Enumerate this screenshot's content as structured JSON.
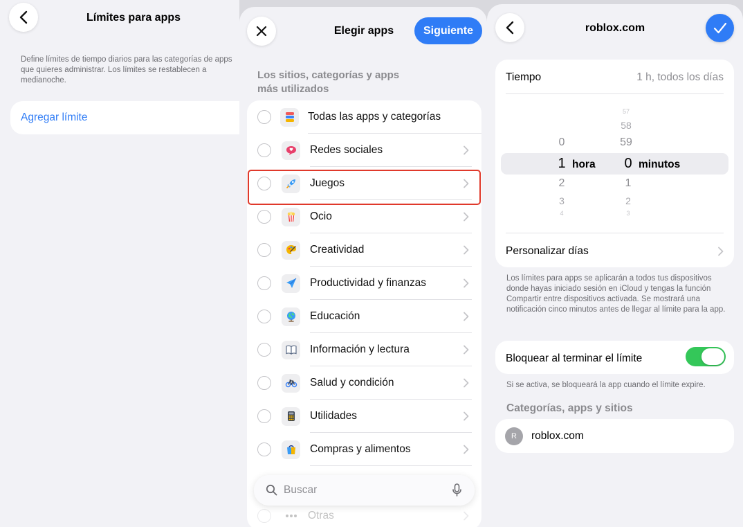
{
  "panel1": {
    "title": "Límites para apps",
    "description": "Define límites de tiempo diarios para las categorías de apps que quieres administrar. Los límites se restablecen a medianoche.",
    "add_limit": "Agregar límite"
  },
  "panel2": {
    "title": "Elegir apps",
    "next_label": "Siguiente",
    "section_header": "Los sitios, categorías y apps más utilizados",
    "items": [
      {
        "label": "Todas las apps y categorías",
        "icon": "stack-icon"
      },
      {
        "label": "Redes sociales",
        "icon": "chat-bubble-icon"
      },
      {
        "label": "Juegos",
        "icon": "rocket-icon"
      },
      {
        "label": "Ocio",
        "icon": "popcorn-icon"
      },
      {
        "label": "Creatividad",
        "icon": "palette-icon"
      },
      {
        "label": "Productividad y finanzas",
        "icon": "paper-plane-icon"
      },
      {
        "label": "Educación",
        "icon": "globe-icon"
      },
      {
        "label": "Información y lectura",
        "icon": "book-icon"
      },
      {
        "label": "Salud y condición",
        "icon": "bicycle-icon"
      },
      {
        "label": "Utilidades",
        "icon": "calculator-icon"
      },
      {
        "label": "Compras y alimentos",
        "icon": "shopping-bag-icon"
      },
      {
        "label": "Otras",
        "icon": "more-icon"
      }
    ],
    "search_placeholder": "Buscar",
    "highlight_color": "#e0392b"
  },
  "panel3": {
    "title": "roblox.com",
    "time_label": "Tiempo",
    "time_value": "1 h, todos los días",
    "picker": {
      "hours_above": [
        "0"
      ],
      "hours_selected": "1",
      "hours_unit": "hora",
      "hours_below": [
        "2",
        "3",
        "4"
      ],
      "minutes_above": [
        "57",
        "58",
        "59"
      ],
      "minutes_selected": "0",
      "minutes_unit": "minutos",
      "minutes_below": [
        "1",
        "2",
        "3"
      ]
    },
    "customize_days": "Personalizar días",
    "info_text": "Los límites para apps se aplicarán a todos tus dispositivos donde hayas iniciado sesión en iCloud y tengas la función Compartir entre dispositivos activada. Se mostrará una notificación cinco minutos antes de llegar al límite para la app.",
    "block_label": "Bloquear al terminar el límite",
    "block_enabled": true,
    "block_note": "Si se activa, se bloqueará la app cuando el límite expire.",
    "section_header": "Categorías, apps y sitios",
    "site_initial": "R",
    "site_name": "roblox.com"
  },
  "colors": {
    "accent": "#2f7cf6",
    "toggle_on": "#34c759",
    "background": "#f2f2f6"
  }
}
